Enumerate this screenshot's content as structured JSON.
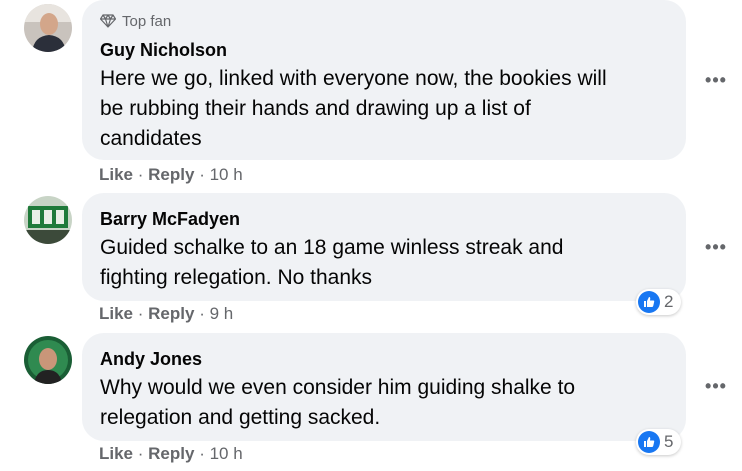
{
  "colors": {
    "accent": "#1877f2",
    "bubble": "#f0f2f5",
    "meta_text": "#65676b"
  },
  "comments": [
    {
      "badge": "Top fan",
      "badge_icon": "diamond-icon",
      "author": "Guy Nicholson",
      "lines": [
        "Here we go, linked with everyone now, the bookies will",
        "be rubbing their hands and drawing up a list of",
        "candidates"
      ],
      "like": "Like",
      "reply": "Reply",
      "time": "10 h",
      "reactions": ""
    },
    {
      "author": "Barry McFadyen",
      "lines": [
        "Guided schalke to an 18 game winless streak and",
        "fighting relegation. No thanks"
      ],
      "like": "Like",
      "reply": "Reply",
      "time": "9 h",
      "reactions": "2"
    },
    {
      "author": "Andy Jones",
      "lines": [
        "Why would we even consider him guiding shalke to",
        "relegation and getting sacked."
      ],
      "like": "Like",
      "reply": "Reply",
      "time": "10 h",
      "reactions": "5"
    }
  ]
}
